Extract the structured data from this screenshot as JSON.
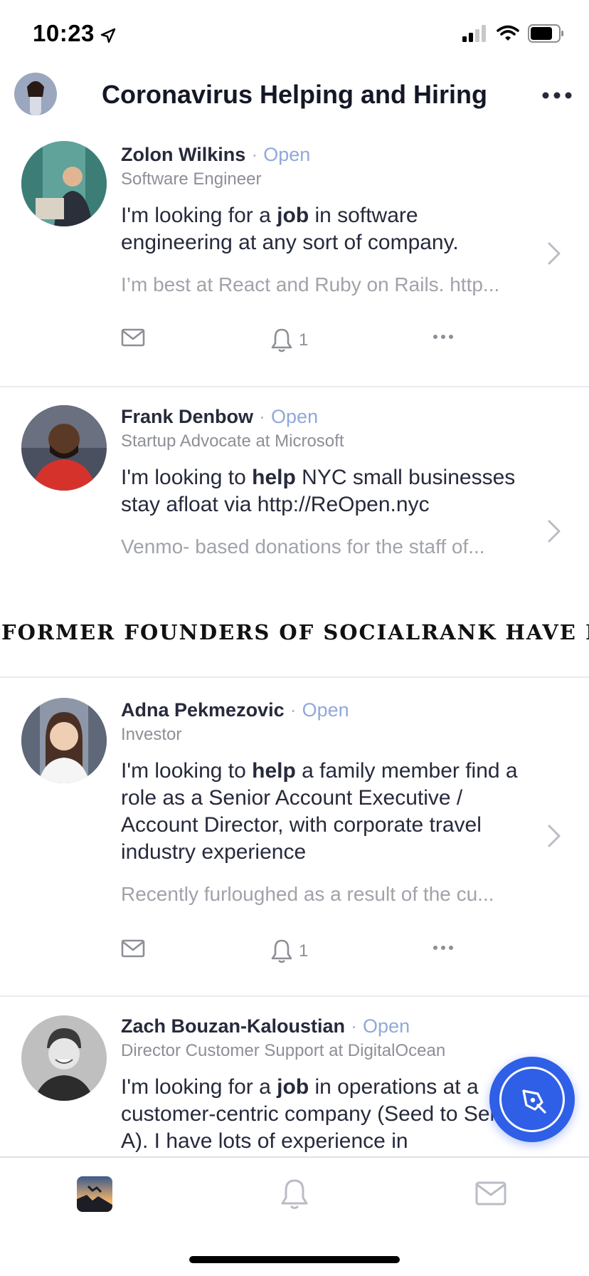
{
  "status_bar": {
    "time": "10:23",
    "icons": [
      "location-arrow-icon",
      "signal-icon",
      "wifi-icon",
      "battery-icon"
    ]
  },
  "header": {
    "title": "Coronavirus Helping and Hiring",
    "avatar": "user-avatar",
    "more_icon": "more-horizontal-icon"
  },
  "posts": [
    {
      "name": "Zolon Wilkins",
      "status": "Open",
      "role": "Software Engineer",
      "text_before": "I'm looking for a ",
      "keyword": "job",
      "text_after": " in software engineering at any sort of company.",
      "preview": "I’m best at React and Ruby on Rails. http...",
      "notifications": "1"
    },
    {
      "name": "Frank Denbow",
      "status": "Open",
      "role": "Startup Advocate at Microsoft",
      "text_before": "I'm looking to ",
      "keyword": "help",
      "text_after": " NYC small businesses stay afloat via http://ReOpen.nyc",
      "preview": "Venmo- based donations for the staff of..."
    },
    {
      "name": "Adna Pekmezovic",
      "status": "Open",
      "role": "Investor",
      "text_before": "I'm looking to ",
      "keyword": "help",
      "text_after": " a family member find a role as a Senior Account Executive / Account Director, with corporate travel industry experience",
      "preview": "Recently furloughed as a result of the cu...",
      "notifications": "1"
    },
    {
      "name": "Zach Bouzan-Kaloustian",
      "status": "Open",
      "role": "Director Customer Support at DigitalOcean",
      "text_before": "I'm looking for a ",
      "keyword": "job",
      "text_after": " in operations at a customer-centric company (Seed to Series A). I have lots of experience in"
    }
  ],
  "overlay_banner": {
    "text": "FORMER FOUNDERS OF SOCIALRANK HAVE LA"
  },
  "fab": {
    "icon": "compose-pen-icon",
    "color": "#2f5fe6"
  },
  "tab_bar": {
    "tabs": [
      "home-thumbnail",
      "bell-icon",
      "mail-icon"
    ]
  },
  "colors": {
    "open_status": "#8fa9d9",
    "text_primary": "#262a3b",
    "text_secondary": "#8d8f96",
    "accent": "#2f5fe6"
  }
}
